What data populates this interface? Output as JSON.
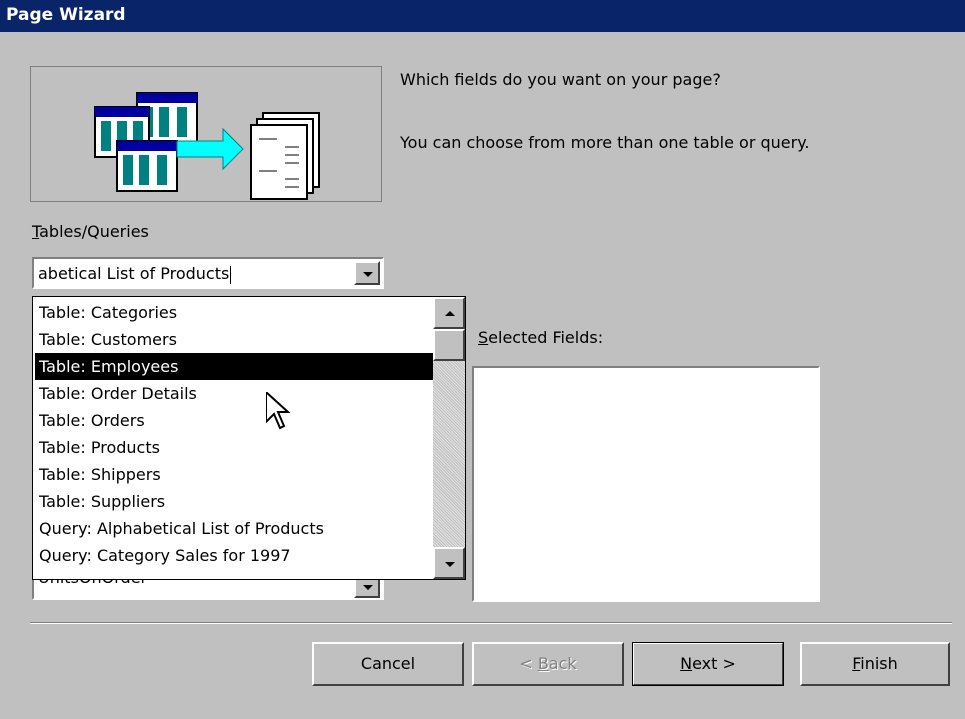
{
  "window": {
    "title": "Page Wizard"
  },
  "prompt": {
    "line1": "Which fields do you want on your page?",
    "line2": "You can choose from more than one table or query."
  },
  "tables_queries": {
    "label": "Tables/Queries",
    "value": "abetical List of Products"
  },
  "dropdown_items": [
    {
      "label": "Table: Categories",
      "selected": false
    },
    {
      "label": "Table: Customers",
      "selected": false
    },
    {
      "label": "Table: Employees",
      "selected": true
    },
    {
      "label": "Table: Order Details",
      "selected": false
    },
    {
      "label": "Table: Orders",
      "selected": false
    },
    {
      "label": "Table: Products",
      "selected": false
    },
    {
      "label": "Table: Shippers",
      "selected": false
    },
    {
      "label": "Table: Suppliers",
      "selected": false
    },
    {
      "label": "Query: Alphabetical List of Products",
      "selected": false
    },
    {
      "label": "Query: Category Sales for 1997",
      "selected": false
    }
  ],
  "available_fields": {
    "visible_partial_item": "UnitsOnOrder"
  },
  "selected_fields": {
    "label": "Selected Fields:"
  },
  "buttons": {
    "cancel": "Cancel",
    "back": "< Back",
    "next": "Next >",
    "finish": "Finish"
  },
  "icons": {
    "wizard_illustration": "tables-to-page-illustration",
    "scroll_up": "scroll-up-arrow-icon",
    "scroll_down": "scroll-down-arrow-icon",
    "dropdown": "chevron-down-icon",
    "cursor": "mouse-pointer-icon"
  },
  "colors": {
    "title_bar": "#0a246a",
    "dialog_face": "#c0c0c0",
    "selection": "#000000",
    "arrow_cyan": "#00ffff"
  }
}
